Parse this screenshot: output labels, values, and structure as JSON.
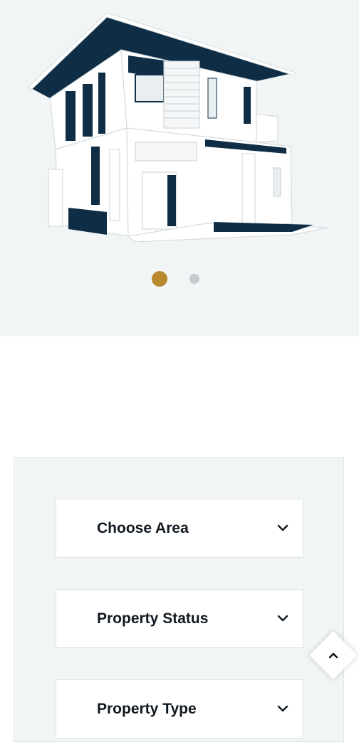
{
  "hero": {
    "image_icon": "house-illustration",
    "carousel": {
      "slide_count": 2,
      "active_index": 0,
      "active_color": "#b8892e",
      "inactive_color": "#c8cbce"
    }
  },
  "search": {
    "fields": [
      {
        "label": "Choose Area",
        "icon": "chevron-down-icon"
      },
      {
        "label": "Property Status",
        "icon": "chevron-down-icon"
      },
      {
        "label": "Property Type",
        "icon": "chevron-down-icon"
      }
    ]
  },
  "back_to_top": {
    "icon": "chevron-up-icon"
  },
  "colors": {
    "navy": "#0f2d45",
    "gold": "#b8892e",
    "panel_bg": "#f1f5f6"
  }
}
